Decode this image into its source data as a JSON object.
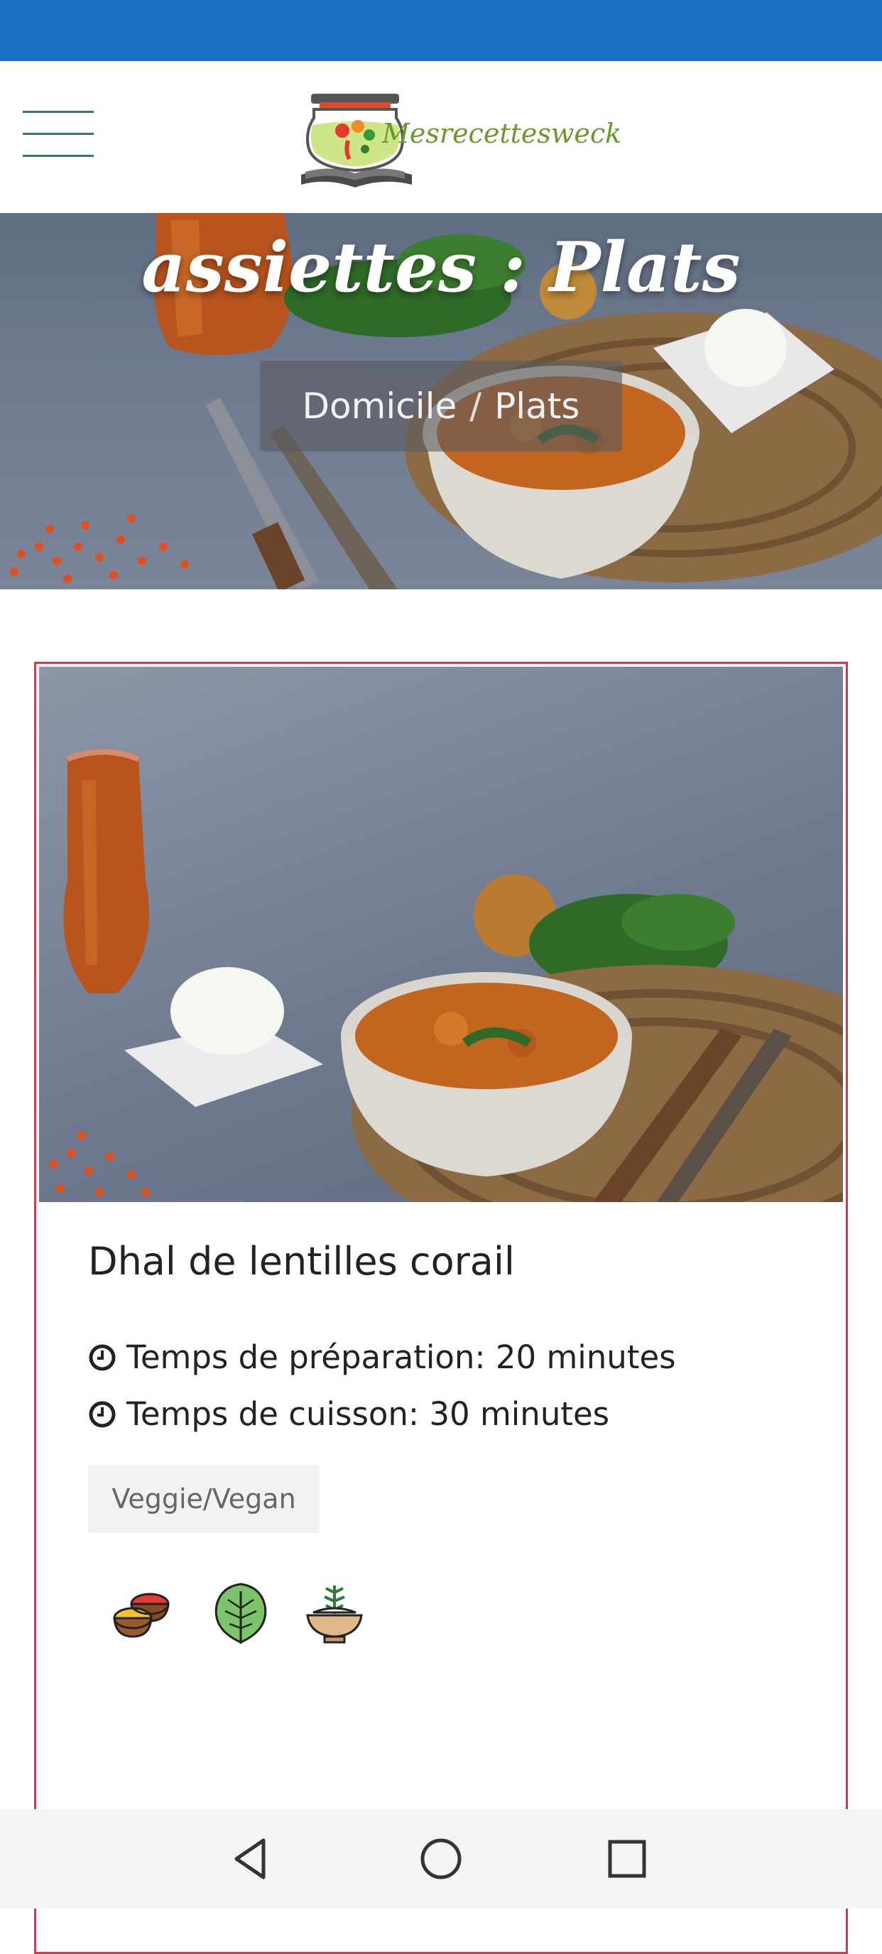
{
  "status_bar": {
    "color": "#1b6fc4"
  },
  "header": {
    "menu_icon": "hamburger-menu-icon",
    "logo_text": "Mesrecettesweck"
  },
  "hero": {
    "title": "assiettes : Plats",
    "breadcrumb": {
      "home": "Domicile",
      "separator": "/",
      "current": "Plats"
    }
  },
  "recipe": {
    "title": "Dhal de lentilles corail",
    "prep_time": "Temps de préparation: 20 minutes",
    "cook_time": "Temps de cuisson: 30 minutes",
    "tag": "Veggie/Vegan",
    "icons": [
      "spices-icon",
      "spinach-leaf-icon",
      "rice-bowl-icon"
    ],
    "border_color": "#d23a54"
  },
  "nav_bar": {
    "icons": [
      "back-triangle-icon",
      "home-circle-icon",
      "recents-square-icon"
    ]
  }
}
